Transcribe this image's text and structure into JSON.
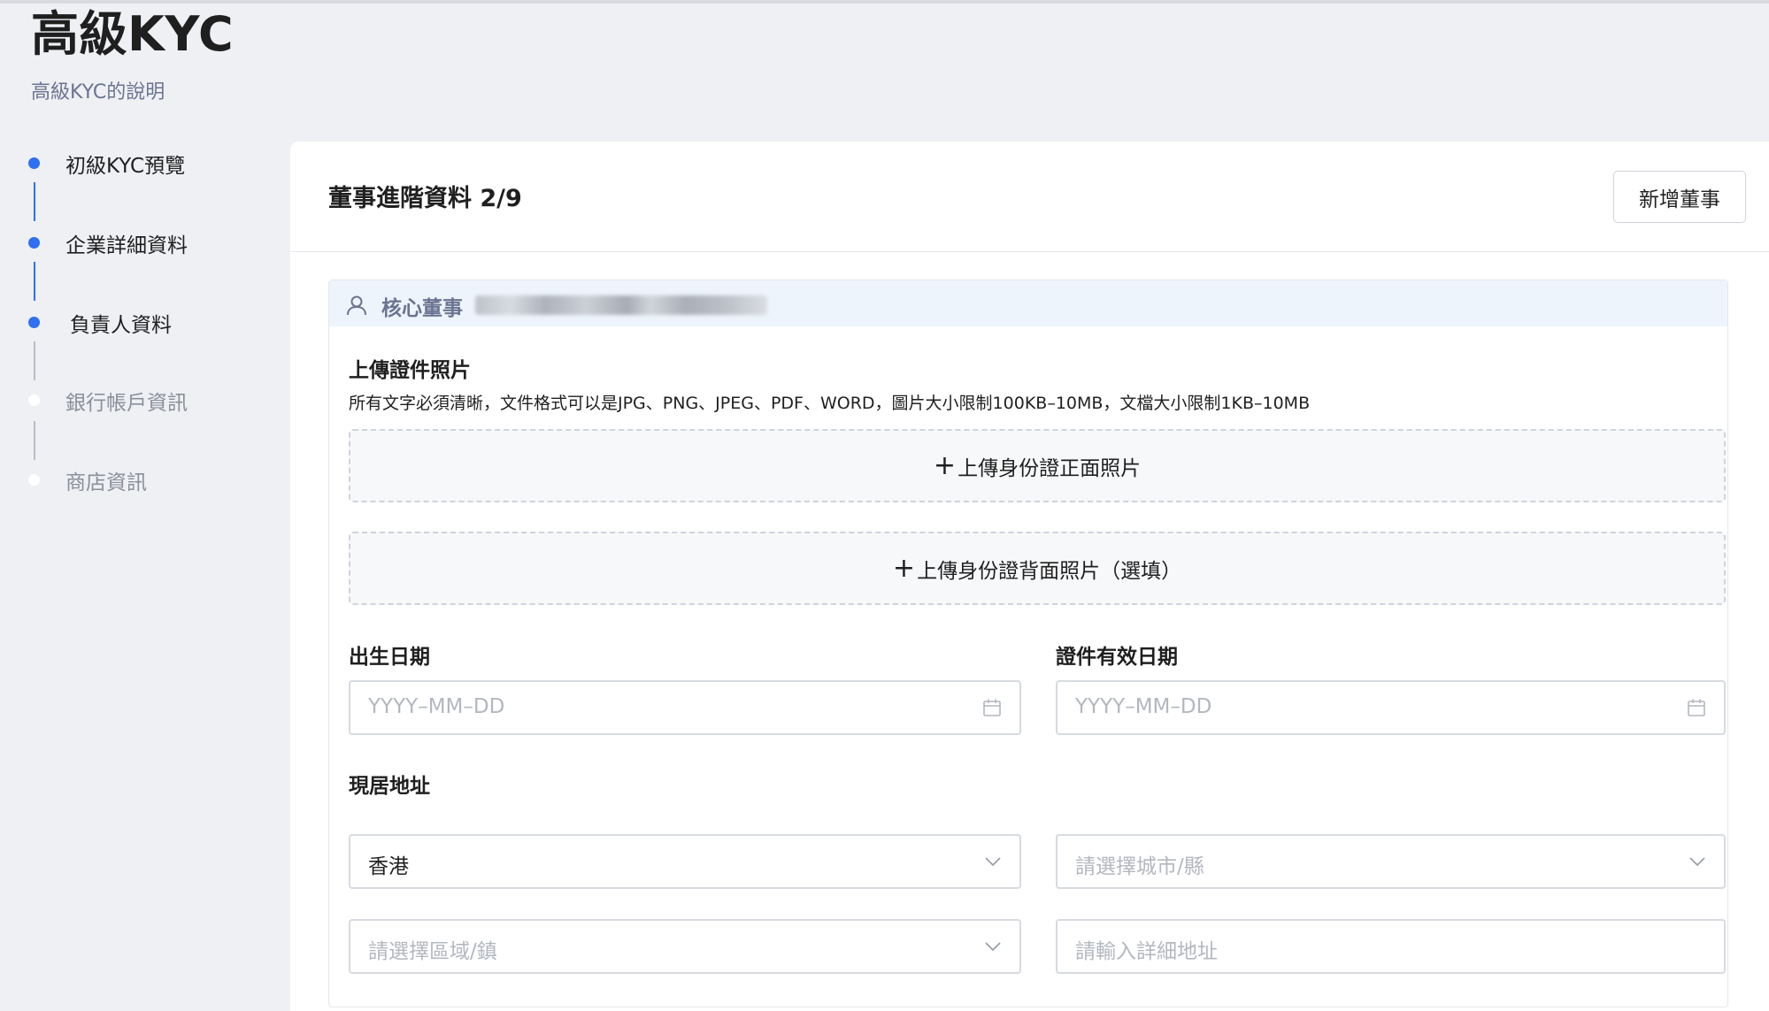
{
  "page": {
    "title": "高級KYC",
    "subtitle": "高級KYC的說明"
  },
  "steps": [
    {
      "label": "初級KYC預覽",
      "state": "done"
    },
    {
      "label": "企業詳細資料",
      "state": "done"
    },
    {
      "label": "負責人資料",
      "state": "active"
    },
    {
      "label": "銀行帳戶資訊",
      "state": "pending"
    },
    {
      "label": "商店資訊",
      "state": "pending"
    }
  ],
  "card": {
    "title": "董事進階資料 2/9",
    "add_button": "新增董事"
  },
  "director": {
    "role": "核心董事"
  },
  "upload": {
    "heading": "上傳證件照片",
    "note": "所有文字必須清晰，文件格式可以是JPG、PNG、JPEG、PDF、WORD，圖片大小限制100KB–10MB，文檔大小限制1KB–10MB",
    "front_label": "上傳身份證正面照片",
    "back_label": "上傳身份證背面照片（選填）",
    "plus": "+"
  },
  "form": {
    "birth_date": {
      "label": "出生日期",
      "placeholder": "YYYY–MM–DD"
    },
    "id_expiry": {
      "label": "證件有效日期",
      "placeholder": "YYYY–MM–DD"
    },
    "address": {
      "label": "現居地址",
      "region_value": "香港",
      "city_placeholder": "請選擇城市/縣",
      "district_placeholder": "請選擇區域/鎮",
      "detail_placeholder": "請輸入詳細地址"
    }
  },
  "colors": {
    "accent": "#2f6ff0",
    "page_bg": "#eef0f4",
    "section_head_bg": "#eef4fc"
  },
  "icons": {
    "user": "user-icon",
    "calendar": "calendar-icon",
    "chevron": "chevron-down-icon"
  }
}
